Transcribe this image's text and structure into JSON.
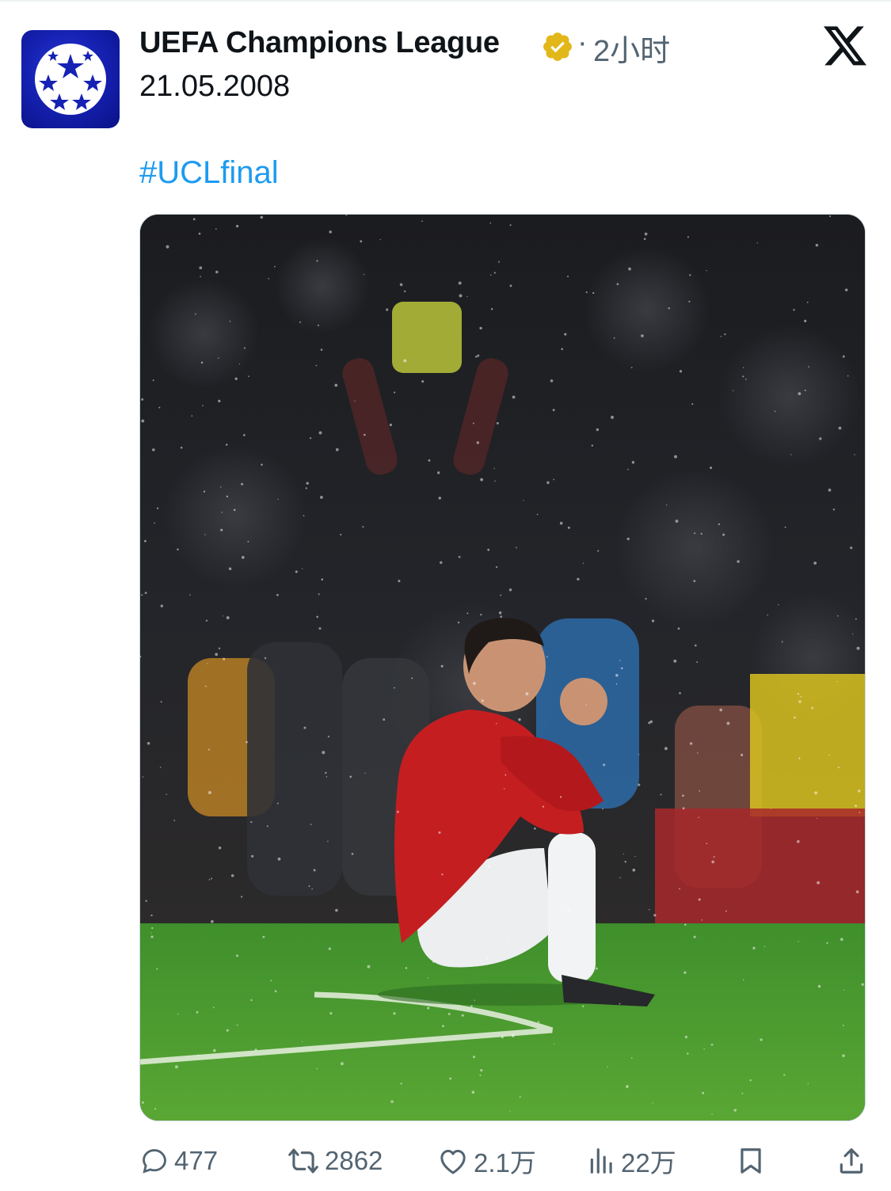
{
  "post": {
    "author_name": "UEFA Champions League",
    "verified_badge": "gold-verified-icon",
    "separator": "·",
    "time_ago": "2小时",
    "date_text": "21.05.2008",
    "hashtag": "#UCLfinal",
    "media_alt": "Player kneeling on the pitch in the rain, fists clenched in celebration"
  },
  "platform": {
    "logo": "x-logo"
  },
  "actions": {
    "reply": {
      "icon": "reply-icon",
      "count": "477"
    },
    "repost": {
      "icon": "repost-icon",
      "count": "2862"
    },
    "like": {
      "icon": "heart-icon",
      "count": "2.1万"
    },
    "views": {
      "icon": "views-icon",
      "count": "22万"
    },
    "bookmark": {
      "icon": "bookmark-icon"
    },
    "share": {
      "icon": "share-icon"
    }
  },
  "colors": {
    "text": "#0f1419",
    "secondary": "#536471",
    "link": "#1d9bf0",
    "avatar_bg": "#1622b4",
    "verified": "#e2b719"
  }
}
